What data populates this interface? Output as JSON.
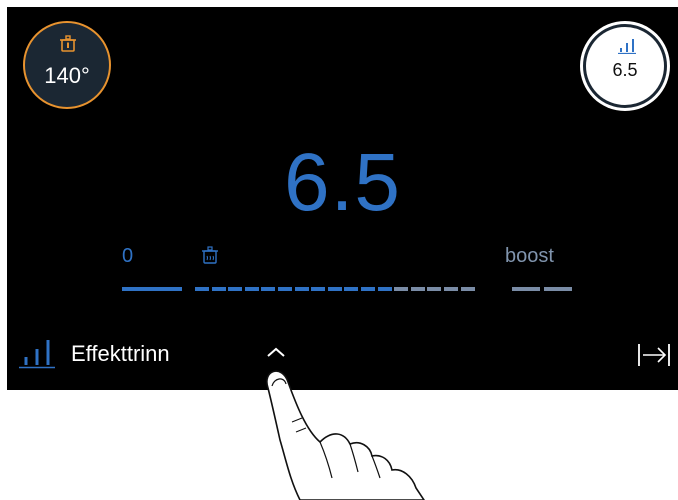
{
  "temperature": {
    "value": "140°",
    "icon": "pot-thermometer-icon",
    "ring_color": "#e8932f"
  },
  "power_level_badge": {
    "value": "6.5",
    "icon": "power-level-icon"
  },
  "main": {
    "value": "6.5",
    "color": "#2f72c5"
  },
  "scale": {
    "min_label": "0",
    "max_label": "boost",
    "marker_icon": "steaming-pot-icon",
    "current_level": 6.5,
    "active_color": "#2f72c5",
    "inactive_color": "#7a8ca6"
  },
  "bottom_bar": {
    "label": "Effekttrinn",
    "label_icon": "power-level-icon",
    "expand_icon": "chevron-up-icon",
    "exit_icon": "exit-arrow-icon"
  }
}
